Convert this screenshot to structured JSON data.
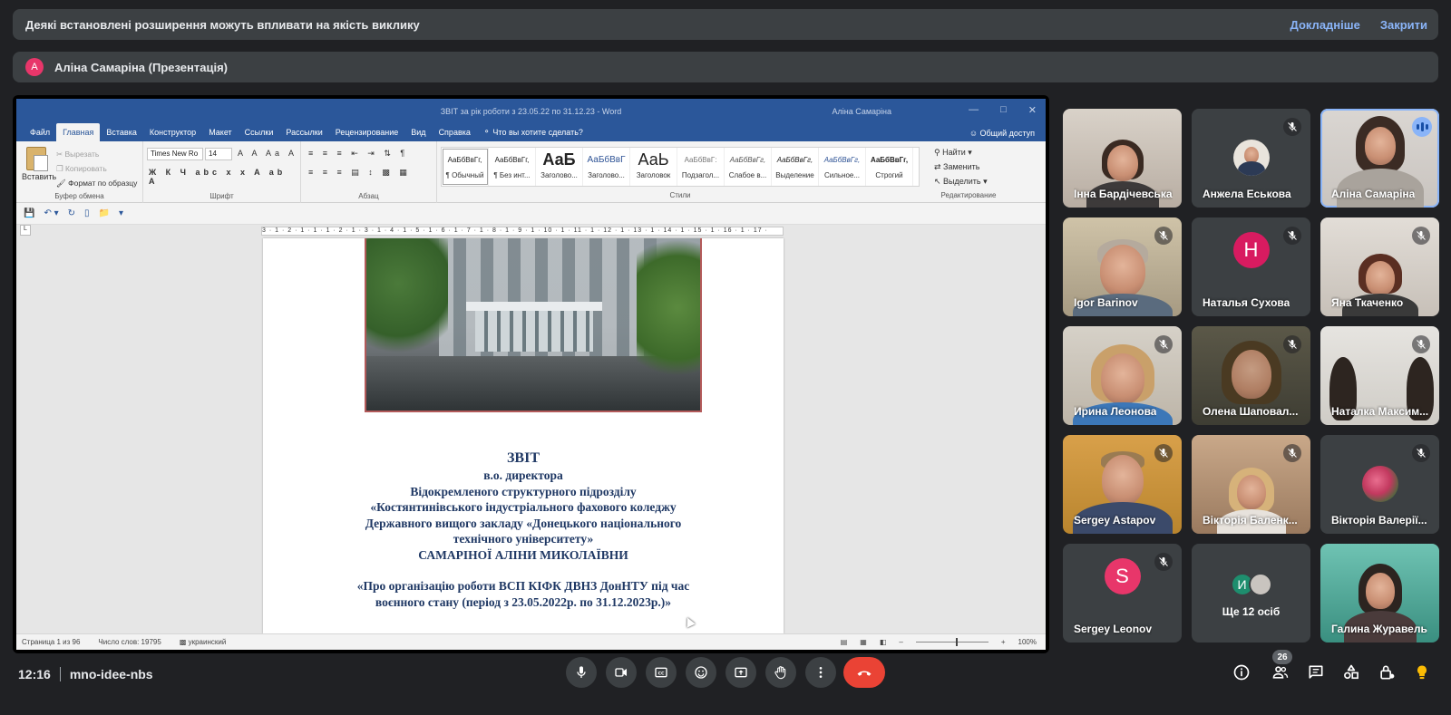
{
  "banners": {
    "extension_warning": "Деякі встановлені розширення можуть впливати на якість виклику",
    "learn_more": "Докладніше",
    "close": "Закрити",
    "presenter_initial": "A",
    "presenter_label": "Аліна Самаріна (Презентація)"
  },
  "word": {
    "doc_title": "ЗВІТ за рік роботи з 23.05.22 по 31.12.23 - Word",
    "user": "Аліна Самаріна",
    "tabs": [
      "Файл",
      "Главная",
      "Вставка",
      "Конструктор",
      "Макет",
      "Ссылки",
      "Рассылки",
      "Рецензирование",
      "Вид",
      "Справка"
    ],
    "active_tab": "Главная",
    "tell_me": "Что вы хотите сделать?",
    "share": "Общий доступ",
    "clipboard": {
      "paste": "Вставить",
      "cut": "Вырезать",
      "copy": "Копировать",
      "format_painter": "Формат по образцу",
      "group": "Буфер обмена"
    },
    "font": {
      "name": "Times New Ro",
      "size": "14",
      "group": "Шрифт"
    },
    "paragraph_group": "Абзац",
    "styles": [
      {
        "preview": "АаБбВвГг,",
        "name": "¶ Обычный"
      },
      {
        "preview": "АаБбВвГг,",
        "name": "¶ Без инт..."
      },
      {
        "preview": "АаБ",
        "name": "Заголово..."
      },
      {
        "preview": "АаБбВвГ",
        "name": "Заголово..."
      },
      {
        "preview": "АаЬ",
        "name": "Заголовок"
      },
      {
        "preview": "АаБбВвГ:",
        "name": "Подзагол..."
      },
      {
        "preview": "АаБбВвГг,",
        "name": "Слабое в..."
      },
      {
        "preview": "АаБбВвГг,",
        "name": "Выделение"
      },
      {
        "preview": "АаБбВвГг,",
        "name": "Сильное..."
      },
      {
        "preview": "АаБбВвГг,",
        "name": "Строгий"
      }
    ],
    "styles_group": "Стили",
    "editing": {
      "find": "Найти",
      "replace": "Заменить",
      "select": "Выделить",
      "group": "Редактирование"
    },
    "ruler": "3 · 1 · 2 · 1 · 1 · 1 · 2 · 1 · 3 · 1 · 4 · 1 · 5 · 1 · 6 · 1 · 7 · 1 · 8 · 1 · 9 · 1 · 10 · 1 · 11 · 1 · 12 · 1 · 13 · 1 · 14 · 1 · 15 · 1 · 16 · 1 · 17 ·",
    "vruler": "L",
    "document": {
      "title": "ЗВІТ",
      "line1": "в.о. директора",
      "line2": "Відокремленого структурного підрозділу",
      "line3": "«Костянтинівського індустріального фахового коледжу",
      "line4": "Державного вищого закладу «Донецького національного",
      "line5": "технічного університету»",
      "line6": "САМАРІНОЇ АЛІНИ МИКОЛАЇВНИ",
      "line7": "«Про організацію роботи  ВСП КІФК ДВНЗ ДонНТУ під час",
      "line8": "воєнного стану (період з 23.05.2022р. по 31.12.2023р.)»"
    },
    "status": {
      "page": "Страница 1 из 96",
      "words": "Число слов: 19795",
      "language": "украинский",
      "zoom": "100%",
      "zoom_level": 1.0
    }
  },
  "participants": [
    {
      "name": "Інна Бардічевська",
      "muted": false,
      "video": true
    },
    {
      "name": "Анжела Еськова",
      "muted": true,
      "video": false
    },
    {
      "name": "Аліна Самаріна",
      "muted": false,
      "speaking": true,
      "video": true
    },
    {
      "name": "Igor Barinov",
      "muted": true,
      "video": true
    },
    {
      "name": "Наталья Сухова",
      "muted": true,
      "video": false,
      "initial": "Н",
      "color": "#d81b60"
    },
    {
      "name": "Яна Ткаченко",
      "muted": true,
      "video": true
    },
    {
      "name": "Ирина Леонова",
      "muted": true,
      "video": true
    },
    {
      "name": "Олена Шаповал...",
      "muted": true,
      "video": true
    },
    {
      "name": "Наталка Максим...",
      "muted": true,
      "video": true
    },
    {
      "name": "Sergey Astapov",
      "muted": true,
      "video": true
    },
    {
      "name": "Вікторія Баленк...",
      "muted": true,
      "video": true
    },
    {
      "name": "Вікторія Валерії...",
      "muted": true,
      "video": false
    },
    {
      "name": "Sergey Leonov",
      "muted": true,
      "video": false,
      "initial": "S",
      "color": "#e8366a"
    },
    {
      "name": "Галина Журавель",
      "muted": false,
      "video": true
    }
  ],
  "others": {
    "label": "Ще 12 осіб",
    "initial": "И",
    "color": "#1e8e6e"
  },
  "bottom": {
    "time": "12:16",
    "meeting_code": "mno-idee-nbs",
    "people_count": "26"
  }
}
